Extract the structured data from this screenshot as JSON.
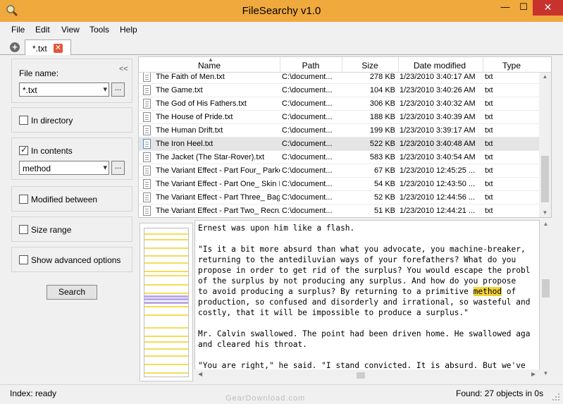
{
  "window": {
    "title": "FileSearchy v1.0",
    "minimize": "—",
    "maximize": "☐",
    "close": "✕"
  },
  "menu": [
    "File",
    "Edit",
    "View",
    "Tools",
    "Help"
  ],
  "tabs": {
    "add": "+",
    "active_label": "*.txt",
    "close": "✕"
  },
  "left": {
    "collapse": "<<",
    "file_name_label": "File name:",
    "file_name_value": "*.txt",
    "browse": "...",
    "in_directory": {
      "label": "In directory",
      "checked": false
    },
    "in_contents": {
      "label": "In contents",
      "checked": true,
      "value": "method"
    },
    "modified_between": {
      "label": "Modified between",
      "checked": false
    },
    "size_range": {
      "label": "Size range",
      "checked": false
    },
    "advanced": {
      "label": "Show advanced options",
      "checked": false
    },
    "search_button": "Search"
  },
  "grid": {
    "columns": [
      "Name",
      "Path",
      "Size",
      "Date modified",
      "Type"
    ],
    "rows": [
      {
        "name": "The Faith of Men.txt",
        "path": "C:\\document...",
        "size": "278 KB",
        "date": "1/23/2010 3:40:17 AM",
        "type": "txt"
      },
      {
        "name": "The Game.txt",
        "path": "C:\\document...",
        "size": "104 KB",
        "date": "1/23/2010 3:40:26 AM",
        "type": "txt"
      },
      {
        "name": "The God of His Fathers.txt",
        "path": "C:\\document...",
        "size": "306 KB",
        "date": "1/23/2010 3:40:32 AM",
        "type": "txt"
      },
      {
        "name": "The House of Pride.txt",
        "path": "C:\\document...",
        "size": "188 KB",
        "date": "1/23/2010 3:40:39 AM",
        "type": "txt"
      },
      {
        "name": "The Human Drift.txt",
        "path": "C:\\document...",
        "size": "199 KB",
        "date": "1/23/2010 3:39:17 AM",
        "type": "txt"
      },
      {
        "name": "The Iron Heel.txt",
        "path": "C:\\document...",
        "size": "522 KB",
        "date": "1/23/2010 3:40:48 AM",
        "type": "txt"
      },
      {
        "name": "The Jacket (The Star-Rover).txt",
        "path": "C:\\document...",
        "size": "583 KB",
        "date": "1/23/2010 3:40:54 AM",
        "type": "txt"
      },
      {
        "name": "The Variant Effect - Part Four_ Parke",
        "path": "C:\\document...",
        "size": "67 KB",
        "date": "1/23/2010 12:45:25 ...",
        "type": "txt"
      },
      {
        "name": "The Variant Effect - Part One_ Skin E",
        "path": "C:\\document...",
        "size": "54 KB",
        "date": "1/23/2010 12:43:50 ...",
        "type": "txt"
      },
      {
        "name": "The Variant Effect - Part Three_ Bag",
        "path": "C:\\document...",
        "size": "52 KB",
        "date": "1/23/2010 12:44:56 ...",
        "type": "txt"
      },
      {
        "name": "The Variant Effect - Part Two_ Recru",
        "path": "C:\\document...",
        "size": "51 KB",
        "date": "1/23/2010 12:44:21 ...",
        "type": "txt"
      }
    ],
    "selected_index": 5
  },
  "preview": {
    "lines": [
      "Ernest was upon him like a flash.",
      "",
      "\"Is it a bit more absurd than what you advocate, you machine-breaker,",
      "returning to the antediluvian ways of your forefathers? What do you",
      "propose in order to get rid of the surplus? You would escape the probl",
      "of the surplus by not producing any surplus. And how do you propose",
      "to avoid producing a surplus? By returning to a primitive |method| of",
      "production, so confused and disorderly and irrational, so wasteful and",
      "costly, that it will be impossible to produce a surplus.\"",
      "",
      "Mr. Calvin swallowed. The point had been driven home. He swallowed aga",
      "and cleared his throat.",
      "",
      "\"You are right,\" he said. \"I stand convicted. It is absurd. But we've"
    ]
  },
  "status": {
    "left": "Index: ready",
    "right": "Found: 27 objects in 0s"
  },
  "watermark": "GearDownload.com"
}
